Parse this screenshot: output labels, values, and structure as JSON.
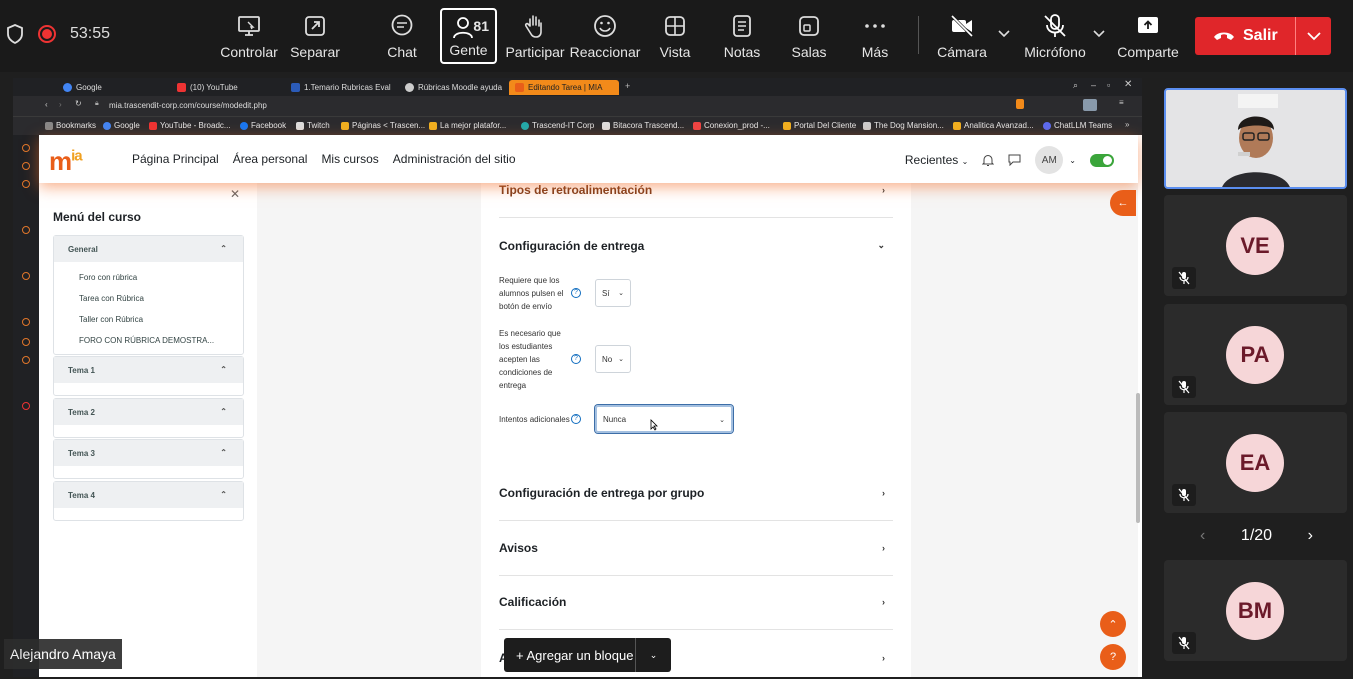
{
  "meeting": {
    "timer": "53:55",
    "participants_count": "81",
    "toolbar": [
      {
        "id": "controlar",
        "label": "Controlar",
        "icon": "remote-control-icon"
      },
      {
        "id": "separar",
        "label": "Separar",
        "icon": "pop-out-icon"
      },
      {
        "id": "chat",
        "label": "Chat",
        "icon": "chat-icon"
      },
      {
        "id": "gente",
        "label": "Gente",
        "icon": "people-icon"
      },
      {
        "id": "participar",
        "label": "Participar",
        "icon": "raise-hand-icon"
      },
      {
        "id": "reaccionar",
        "label": "Reaccionar",
        "icon": "smiley-icon"
      },
      {
        "id": "vista",
        "label": "Vista",
        "icon": "grid-view-icon"
      },
      {
        "id": "notas",
        "label": "Notas",
        "icon": "notes-icon"
      },
      {
        "id": "salas",
        "label": "Salas",
        "icon": "rooms-icon"
      },
      {
        "id": "mas",
        "label": "Más",
        "icon": "more-icon"
      },
      {
        "id": "camara",
        "label": "Cámara",
        "icon": "camera-off-icon"
      },
      {
        "id": "microfono",
        "label": "Micrófono",
        "icon": "mic-off-icon"
      },
      {
        "id": "comparte",
        "label": "Comparte",
        "icon": "share-screen-icon"
      }
    ],
    "leave_label": "Salir",
    "speaker_name": "Alejandro Amaya",
    "pager": "1/20",
    "tiles": [
      {
        "initials": "VE"
      },
      {
        "initials": "PA"
      },
      {
        "initials": "EA"
      },
      {
        "initials": "BM"
      }
    ]
  },
  "browser": {
    "tabs": [
      "Google",
      "(10) YouTube",
      "1.Temario Rubricas Evalu",
      "Rúbricas Moodle ayuda",
      "Editando Tarea | MIA"
    ],
    "url": "mia.trascendit-corp.com/course/modedit.php",
    "bookmarks": [
      "Bookmarks",
      "Google",
      "YouTube - Broadc...",
      "Facebook",
      "Twitch",
      "Páginas < Trascen...",
      "La mejor platafor...",
      "Trascend-IT Corp",
      "Bitacora Trascend...",
      "Conexion_prod -...",
      "Portal Del Cliente",
      "The Dog Mansion...",
      "Analitica Avanzad...",
      "ChatLLM Teams"
    ]
  },
  "moodle": {
    "logo_main": "m",
    "logo_sup": "ia",
    "nav": [
      "Página Principal",
      "Área personal",
      "Mis cursos",
      "Administración del sitio"
    ],
    "recientes": "Recientes",
    "avatar": "AM",
    "drawer": {
      "title": "Menú del curso",
      "sections": [
        {
          "name": "General",
          "items": [
            "Foro con rúbrica",
            "Tarea con Rúbrica",
            "Taller con Rúbrica",
            "FORO CON RÚBRICA DEMOSTRA..."
          ]
        },
        {
          "name": "Tema 1",
          "items": []
        },
        {
          "name": "Tema 2",
          "items": []
        },
        {
          "name": "Tema 3",
          "items": []
        },
        {
          "name": "Tema 4",
          "items": []
        }
      ]
    },
    "form": {
      "feedback_types": "Tipos de retroalimentación",
      "submission_settings": "Configuración de entrega",
      "require_submit_label": "Requiere que los alumnos pulsen el botón de envío",
      "require_submit_value": "Sí",
      "accept_terms_label": "Es necesario que los estudiantes acepten las condiciones de entrega",
      "accept_terms_value": "No",
      "additional_attempts_label": "Intentos adicionales",
      "additional_attempts_value": "Nunca",
      "group_submission": "Configuración de entrega por grupo",
      "notices": "Avisos",
      "grade": "Calificación",
      "next_partial": "A"
    },
    "add_block": "+ Agregar un bloque"
  }
}
